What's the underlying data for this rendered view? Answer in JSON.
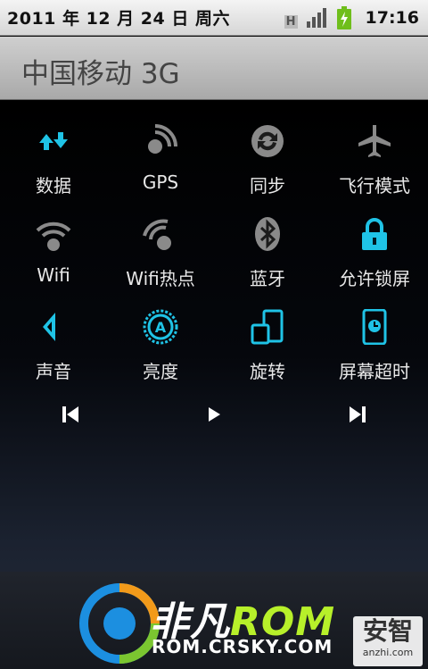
{
  "status_bar": {
    "date": "2011 年 12 月 24 日 周六",
    "network_type": "H",
    "time": "17:16",
    "icons": [
      "network-h-icon",
      "signal-bars-icon",
      "battery-charging-icon"
    ]
  },
  "carrier": {
    "name": "中国移动 3G"
  },
  "toggles": [
    {
      "label": "数据",
      "icon": "data-arrows-icon",
      "active": true
    },
    {
      "label": "GPS",
      "icon": "gps-satellite-icon",
      "active": false
    },
    {
      "label": "同步",
      "icon": "sync-icon",
      "active": false
    },
    {
      "label": "飞行模式",
      "icon": "airplane-icon",
      "active": false
    },
    {
      "label": "Wifi",
      "icon": "wifi-icon",
      "active": false
    },
    {
      "label": "Wifi热点",
      "icon": "wifi-hotspot-icon",
      "active": false
    },
    {
      "label": "蓝牙",
      "icon": "bluetooth-icon",
      "active": false
    },
    {
      "label": "允许锁屏",
      "icon": "lock-icon",
      "active": true
    },
    {
      "label": "声音",
      "icon": "speaker-icon",
      "active": true
    },
    {
      "label": "亮度",
      "icon": "brightness-auto-icon",
      "active": true
    },
    {
      "label": "旋转",
      "icon": "rotate-screen-icon",
      "active": true
    },
    {
      "label": "屏幕超时",
      "icon": "screen-timeout-icon",
      "active": true
    }
  ],
  "media_controls": [
    "previous-icon",
    "play-icon",
    "next-icon"
  ],
  "footer": {
    "brand_text": "非凡",
    "brand_rom": "ROM",
    "brand_url": "ROM.CRSKY.COM",
    "watermark_main": "安智",
    "watermark_sub": "anzhi.com"
  },
  "colors": {
    "active": "#1fc3e6",
    "inactive": "#8a8a8a",
    "rom_green": "#b7f02a"
  }
}
